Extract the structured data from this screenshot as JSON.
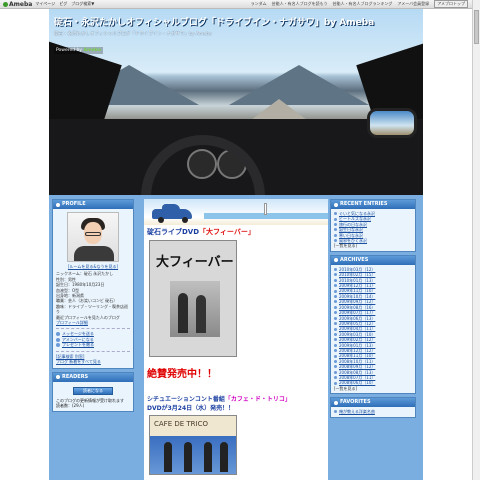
{
  "topbar": {
    "logo": "Ameba",
    "links": [
      "マイページ",
      "ピグ",
      "ブログ検索▼"
    ],
    "right_links": [
      "ランダム",
      "芸能人・有名人ブログを読もう",
      "芸能人・有名人ブログランキング",
      "アメーバ会員登録"
    ],
    "button": "アメブロトップ"
  },
  "header": {
    "title": "碇石・永沢たかしオフィシャルブログ「ドライブイン・ナガサワ」by Ameba",
    "subtitle": "碇石・永沢たかしオフィシャルブログ「ドライブイン・ナガサワ」by Ameba",
    "powered": "Powered by",
    "powered_brand": "Ameba"
  },
  "profile": {
    "heading": "PROFILE",
    "more_link": "[ルームを見る&なうを見る]",
    "lines": [
      "ニックネーム：碇石 永沢たかし",
      "性別：男性",
      "誕生日：1980年10月23日",
      "血液型：O型",
      "出身地：新潟県",
      "職業：芸人（お笑いコンビ 碇石）",
      "趣味：ドライブ・ツーリング・喫茶店巡り",
      "最近プロフィールを見た人のブログ",
      "プロフィール詳細"
    ],
    "links": [
      "メッセージを送る",
      "アメンバーになる",
      "プレゼントを贈る"
    ],
    "footer": "[記事検索 別窓]",
    "footer2": "ブログ 新着をすべて見る"
  },
  "readers": {
    "heading": "READERS",
    "button": "読者になる",
    "text": "このブログの更新情報が受け取れます",
    "count": "読者数：(29人)"
  },
  "post": {
    "title_prefix": "碇石ライブDVD",
    "title_quoted": "「大フィーバー」",
    "dvd_cover_title": "大フィーバー",
    "sale_text": "絶賛発売中！！",
    "line1_prefix": "シチュエーションコント番組",
    "line1_quoted": "「カフェ・ド・トリコ」",
    "line2": "DVDが3月24日（水）発売！！",
    "cafe_cover_title": "CAFE DE TRICO"
  },
  "recent": {
    "heading": "RECENT ENTRIES",
    "items": [
      "ぐいと気になる永沢",
      "ビートルズな永沢",
      "旅行の日な永沢",
      "誕生日な永沢",
      "寒い日な永沢",
      "風邪をひく永沢"
    ],
    "more": "[一覧を見る]"
  },
  "archives": {
    "heading": "ARCHIVES",
    "items": [
      "2010年03月（12）",
      "2010年02月（15）",
      "2010年01月（13）",
      "2009年12月（11）",
      "2009年11月（10）",
      "2009年10月（14）",
      "2009年09月（12）",
      "2009年08月（16）",
      "2009年07月（17）",
      "2009年06月（13）",
      "2009年05月（12）",
      "2009年04月（11）",
      "2009年03月（10）",
      "2009年02月（12）",
      "2009年01月（13）",
      "2008年12月（12）",
      "2008年11月（10）",
      "2008年10月（11）",
      "2008年09月（12）",
      "2008年08月（13）",
      "2008年07月（11）",
      "2008年06月（10）"
    ],
    "more": "[一覧を見る]"
  },
  "favorites": {
    "heading": "FAVORITES",
    "items": [
      "俺が教える洋楽名曲"
    ]
  }
}
